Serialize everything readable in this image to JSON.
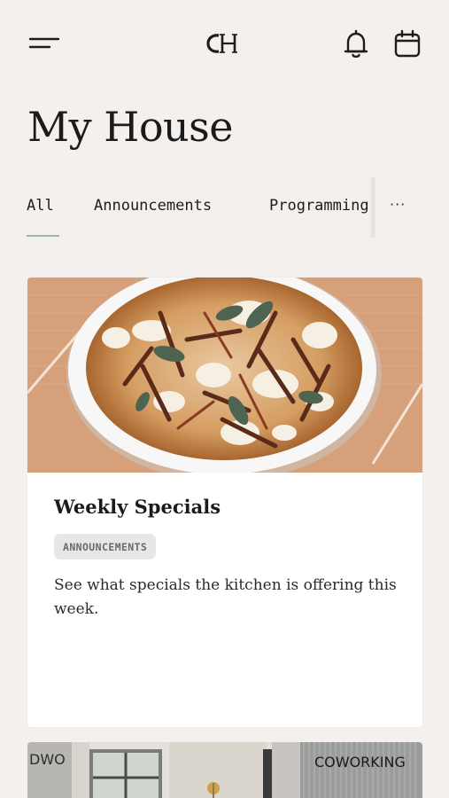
{
  "header": {
    "logo_text": "CH",
    "menu_icon": "menu-icon",
    "notifications_icon": "bell-icon",
    "calendar_icon": "calendar-icon"
  },
  "page": {
    "title": "My House"
  },
  "tabs": [
    {
      "label": "All",
      "active": true
    },
    {
      "label": "Announcements",
      "active": false
    },
    {
      "label": "Programming",
      "active": false
    }
  ],
  "tabs_more": "···",
  "colors": {
    "background": "#f3f0ed",
    "active_tab_underline": "#9fb7a9",
    "card_background": "#ffffff",
    "tag_background": "#e9e7e5"
  },
  "feed": [
    {
      "title": "Weekly Specials",
      "tag": "ANNOUNCEMENTS",
      "description": "See what specials the kitchen is offering this week."
    },
    {
      "image_text_left": "DWO",
      "image_text_right": "COWORKING"
    }
  ]
}
